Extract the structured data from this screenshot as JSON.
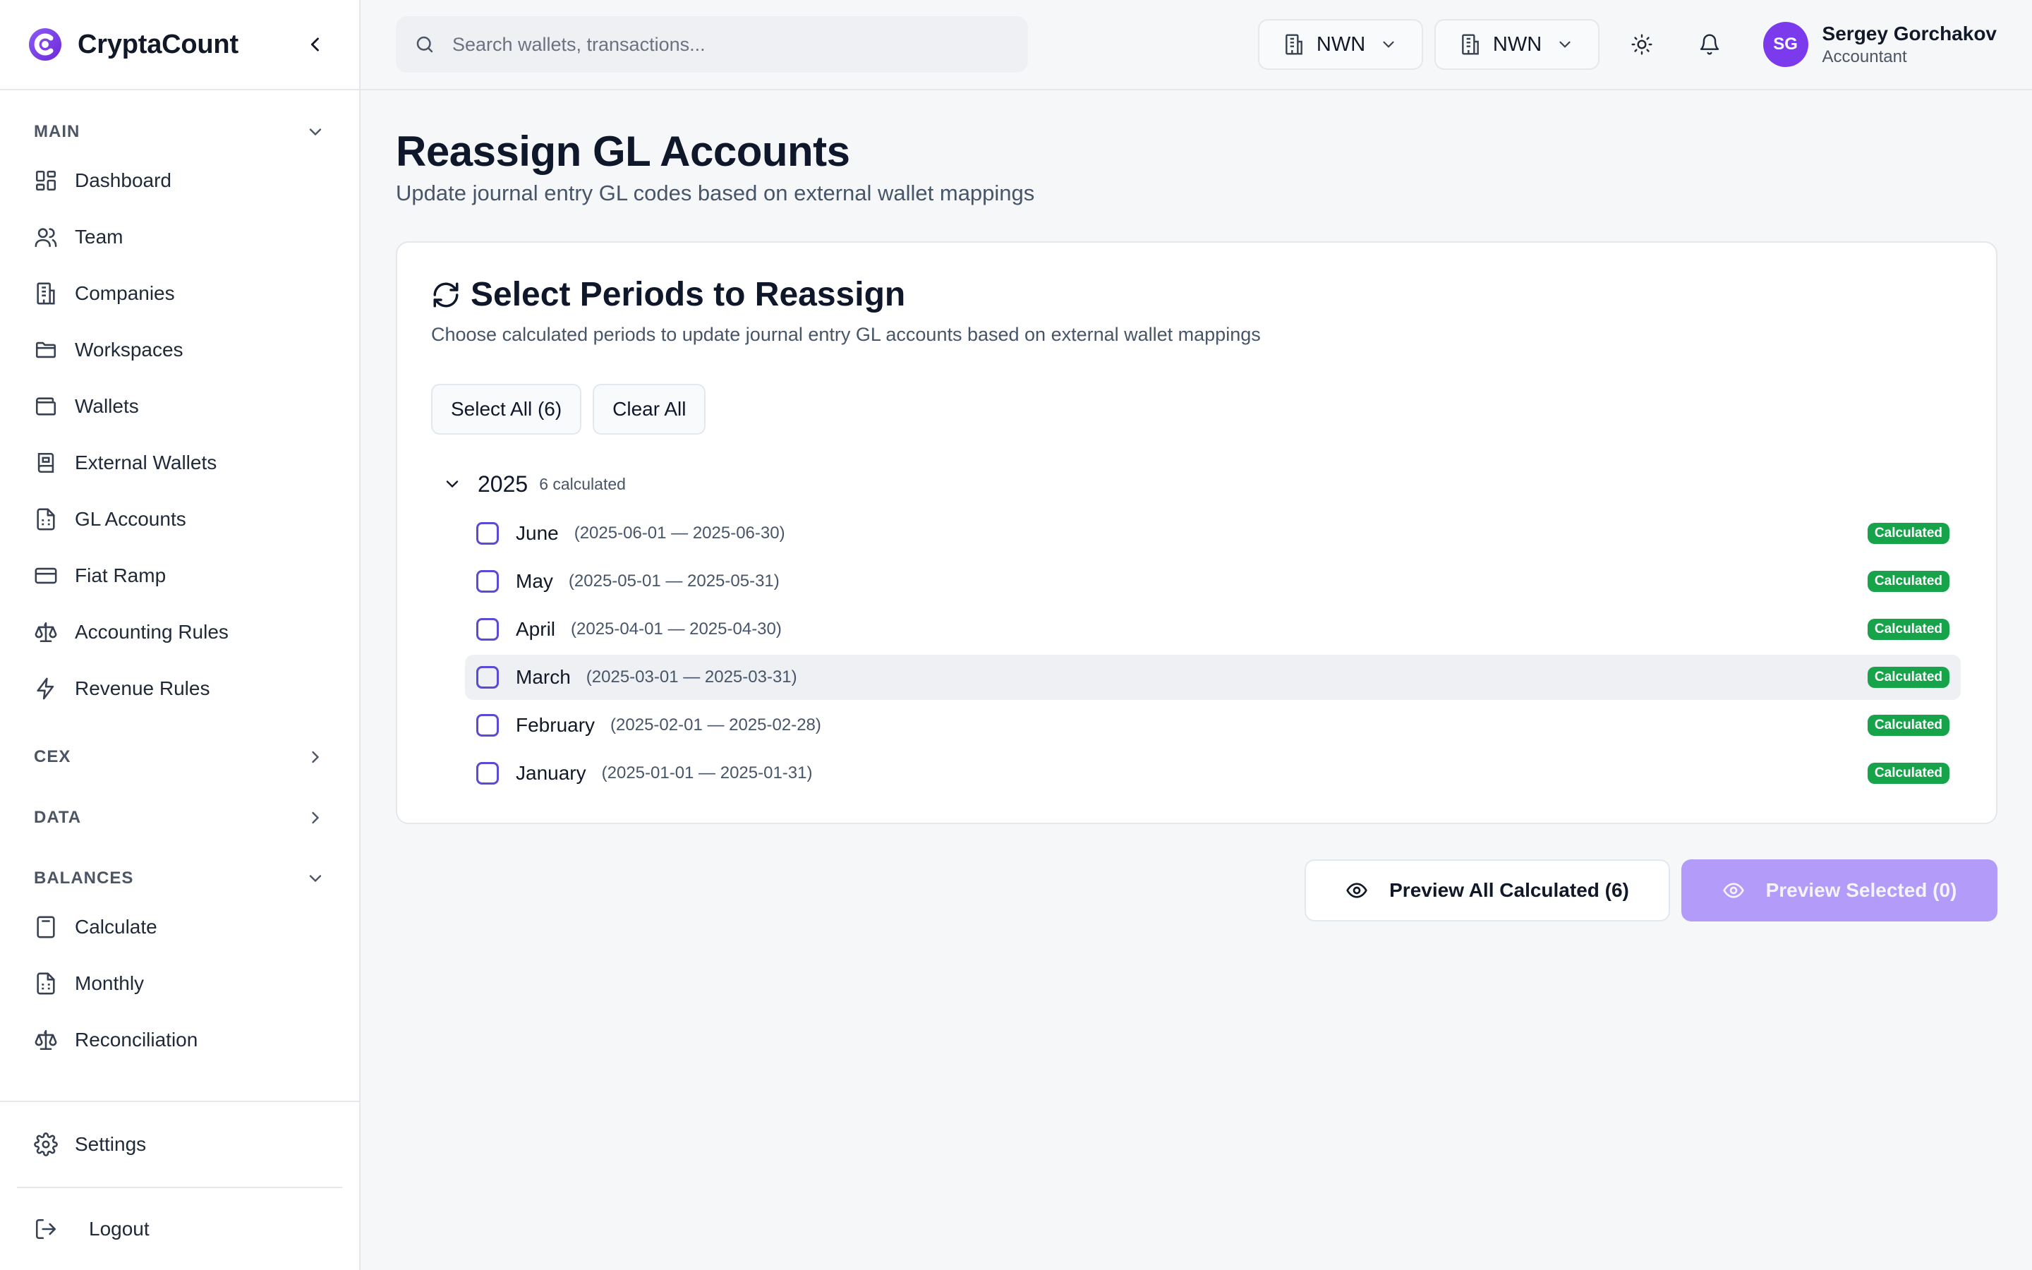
{
  "app": {
    "name": "CryptaCount"
  },
  "search": {
    "placeholder": "Search wallets, transactions..."
  },
  "header": {
    "org_selectors": [
      {
        "label": "NWN"
      },
      {
        "label": "NWN"
      }
    ],
    "user": {
      "initials": "SG",
      "name": "Sergey Gorchakov",
      "role": "Accountant"
    }
  },
  "sidebar": {
    "sections": {
      "main": "MAIN",
      "cex": "CEX",
      "data": "DATA",
      "balances": "BALANCES"
    },
    "main_items": [
      {
        "label": "Dashboard",
        "icon": "dashboard-icon"
      },
      {
        "label": "Team",
        "icon": "users-icon"
      },
      {
        "label": "Companies",
        "icon": "building-icon"
      },
      {
        "label": "Workspaces",
        "icon": "folder-icon"
      },
      {
        "label": "Wallets",
        "icon": "wallet-icon"
      },
      {
        "label": "External Wallets",
        "icon": "book-icon"
      },
      {
        "label": "GL Accounts",
        "icon": "file-spreadsheet-icon"
      },
      {
        "label": "Fiat Ramp",
        "icon": "credit-card-icon"
      },
      {
        "label": "Accounting Rules",
        "icon": "scale-icon"
      },
      {
        "label": "Revenue Rules",
        "icon": "zap-icon"
      }
    ],
    "balances_items": [
      {
        "label": "Calculate",
        "icon": "calculator-icon"
      },
      {
        "label": "Monthly",
        "icon": "file-spreadsheet-icon"
      },
      {
        "label": "Reconciliation",
        "icon": "scale-icon"
      }
    ],
    "settings": "Settings",
    "logout": "Logout"
  },
  "page": {
    "title": "Reassign GL Accounts",
    "subtitle": "Update journal entry GL codes based on external wallet mappings"
  },
  "card": {
    "title": "Select Periods to Reassign",
    "description": "Choose calculated periods to update journal entry GL accounts based on external wallet mappings",
    "select_all": "Select All (6)",
    "clear_all": "Clear All",
    "year": "2025",
    "year_count": "6 calculated",
    "periods": [
      {
        "name": "June",
        "range": "(2025-06-01 — 2025-06-30)",
        "status": "Calculated"
      },
      {
        "name": "May",
        "range": "(2025-05-01 — 2025-05-31)",
        "status": "Calculated"
      },
      {
        "name": "April",
        "range": "(2025-04-01 — 2025-04-30)",
        "status": "Calculated"
      },
      {
        "name": "March",
        "range": "(2025-03-01 — 2025-03-31)",
        "status": "Calculated"
      },
      {
        "name": "February",
        "range": "(2025-02-01 — 2025-02-28)",
        "status": "Calculated"
      },
      {
        "name": "January",
        "range": "(2025-01-01 — 2025-01-31)",
        "status": "Calculated"
      }
    ]
  },
  "actions": {
    "preview_all": "Preview All Calculated (6)",
    "preview_selected": "Preview Selected (0)"
  },
  "colors": {
    "accent": "#7c3aed",
    "badge_green": "#16a34a",
    "disabled_button": "#a78bfa",
    "checkbox_border": "#5b4ad6"
  }
}
